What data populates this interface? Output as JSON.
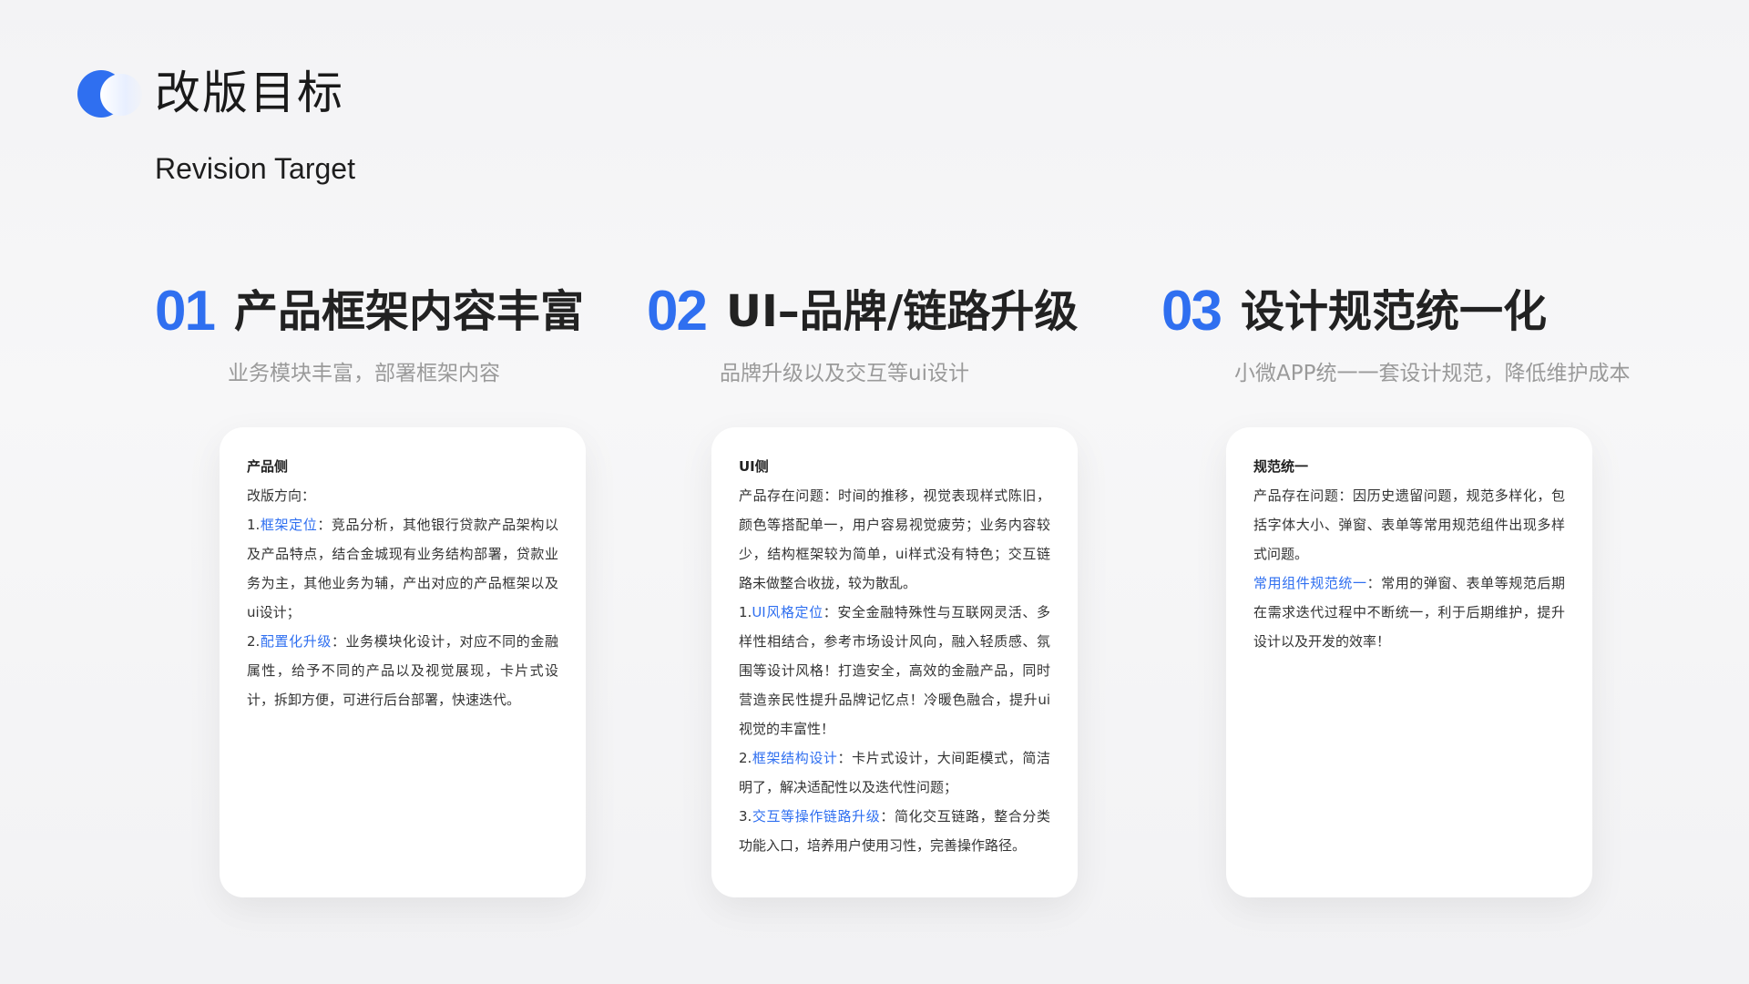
{
  "header": {
    "title": "改版目标",
    "subtitle": "Revision Target"
  },
  "sections": [
    {
      "num": "01",
      "title": "产品框架内容丰富",
      "desc": "业务模块丰富，部署框架内容",
      "card": {
        "heading": "产品侧",
        "intro": "改版方向：",
        "items": [
          {
            "prefix": "1.",
            "highlight": "框架定位",
            "text": "：竞品分析，其他银行贷款产品架构以及产品特点，结合金城现有业务结构部署，贷款业务为主，其他业务为辅，产出对应的产品框架以及ui设计；"
          },
          {
            "prefix": "2.",
            "highlight": "配置化升级",
            "text": "：业务模块化设计，对应不同的金融属性，给予不同的产品以及视觉展现，卡片式设计，拆卸方便，可进行后台部署，快速迭代。"
          }
        ]
      }
    },
    {
      "num": "02",
      "title": "UI–品牌/链路升级",
      "desc": "品牌升级以及交互等ui设计",
      "card": {
        "heading": "UI侧",
        "intro": "产品存在问题：时间的推移，视觉表现样式陈旧，颜色等搭配单一，用户容易视觉疲劳；业务内容较少，结构框架较为简单，ui样式没有特色；交互链路未做整合收拢，较为散乱。",
        "items": [
          {
            "prefix": "1.",
            "highlight": "UI风格定位",
            "text": "：安全金融特殊性与互联网灵活、多样性相结合，参考市场设计风向，融入轻质感、氛围等设计风格！打造安全，高效的金融产品，同时营造亲民性提升品牌记忆点！冷暖色融合，提升ui视觉的丰富性！"
          },
          {
            "prefix": "2.",
            "highlight": "框架结构设计",
            "text": "：卡片式设计，大间距模式，简洁明了，解决适配性以及迭代性问题；"
          },
          {
            "prefix": "3.",
            "highlight": "交互等操作链路升级",
            "text": "：简化交互链路，整合分类功能入口，培养用户使用习性，完善操作路径。"
          }
        ]
      }
    },
    {
      "num": "03",
      "title": "设计规范统一化",
      "desc": "小微APP统一一套设计规范，降低维护成本",
      "card": {
        "heading": "规范统一",
        "intro": "产品存在问题：因历史遗留问题，规范多样化，包括字体大小、弹窗、表单等常用规范组件出现多样式问题。",
        "items": [
          {
            "prefix": "",
            "highlight": "常用组件规范统一",
            "text": "：常用的弹窗、表单等规范后期在需求迭代过程中不断统一，利于后期维护，提升设计以及开发的效率！"
          }
        ]
      }
    }
  ],
  "colors": {
    "accent": "#2f6ff0",
    "muted": "#9a9a9a",
    "text": "#333333"
  }
}
